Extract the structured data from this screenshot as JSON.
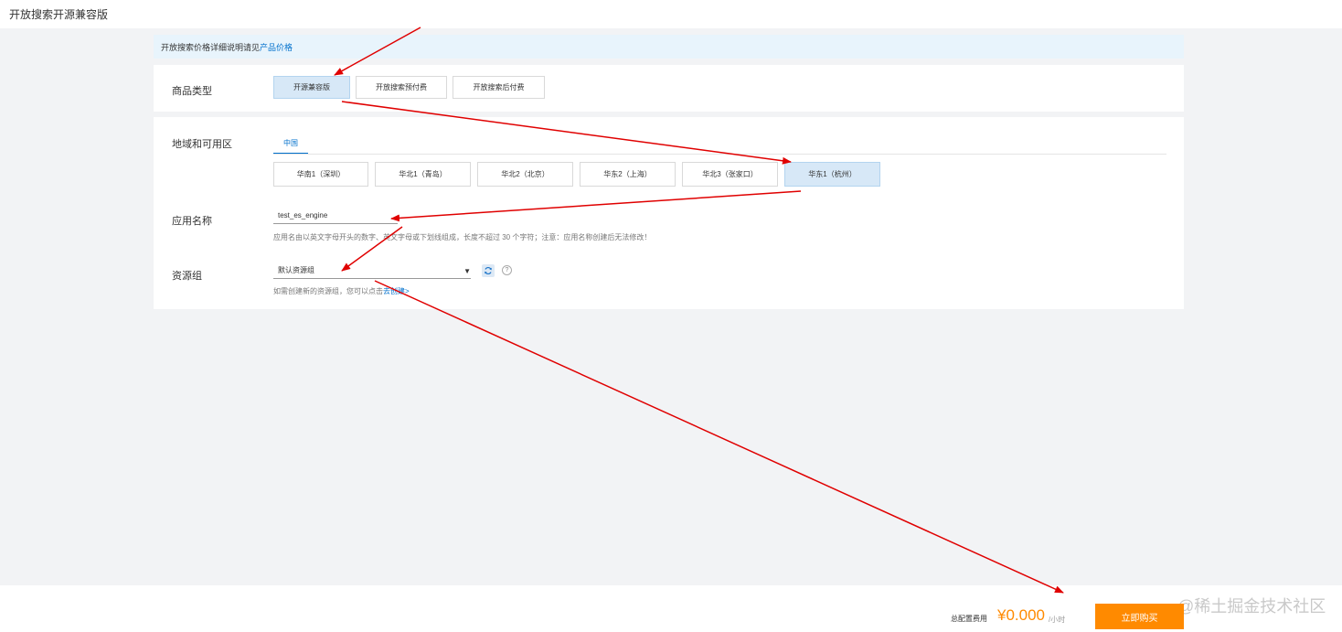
{
  "header": {
    "title": "开放搜索开源兼容版"
  },
  "notice": {
    "text": "开放搜索价格详细说明请见",
    "link": "产品价格"
  },
  "product_type": {
    "label": "商品类型",
    "options": [
      "开源兼容版",
      "开放搜索预付费",
      "开放搜索后付费"
    ],
    "selected": "开源兼容版"
  },
  "region": {
    "label": "地域和可用区",
    "tab": "中国",
    "options": [
      "华南1（深圳）",
      "华北1（青岛）",
      "华北2（北京）",
      "华东2（上海）",
      "华北3（张家口）",
      "华东1（杭州）"
    ],
    "selected": "华东1（杭州）"
  },
  "app_name": {
    "label": "应用名称",
    "value": "test_es_engine",
    "hint": "应用名由以英文字母开头的数字、英文字母或下划线组成，长度不超过 30 个字符；注意：应用名称创建后无法修改！"
  },
  "resource_group": {
    "label": "资源组",
    "value": "默认资源组",
    "hint": "如需创建新的资源组，您可以点击",
    "link": "去创建>"
  },
  "footer": {
    "fee_label": "总配置费用",
    "fee_value": "¥0.000",
    "fee_unit": "/小时",
    "buy_label": "立即购买",
    "watermark": "@稀土掘金技术社区"
  },
  "colors": {
    "accent": "#0070cc",
    "buy": "#ff8a00",
    "annotation": "#e00000"
  }
}
